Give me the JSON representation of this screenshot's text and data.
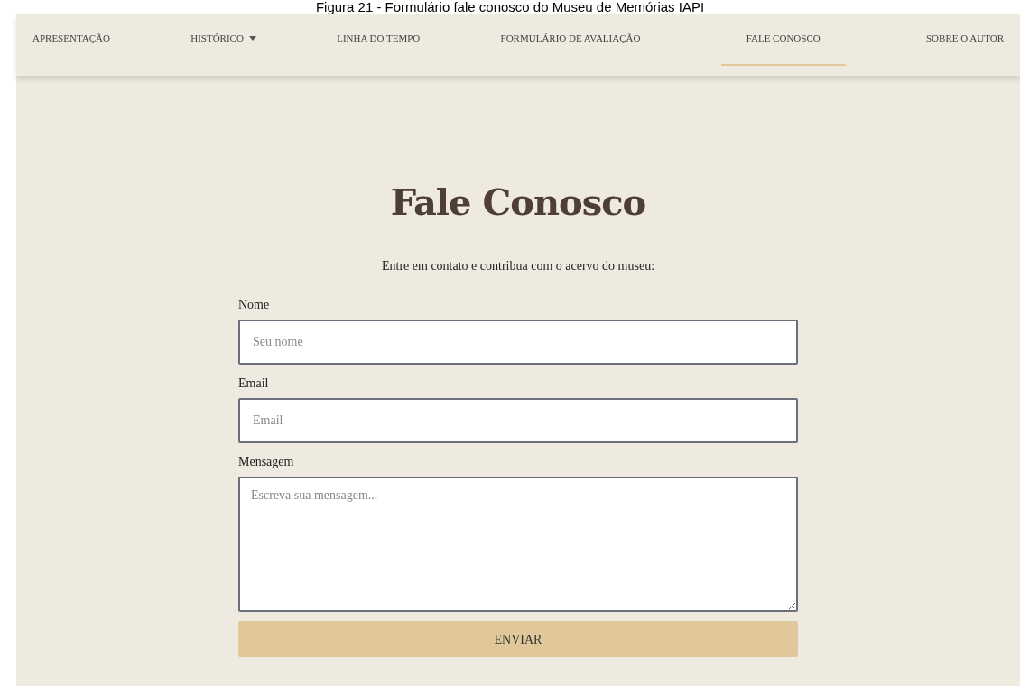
{
  "caption": "Figura 21 - Formulário fale conosco do Museu de Memórias IAPI",
  "nav": [
    {
      "label": "APRESENTAÇÃO",
      "selected": false,
      "dropdown": false
    },
    {
      "label": "HISTÓRICO",
      "selected": false,
      "dropdown": true
    },
    {
      "label": "LINHA DO TEMPO",
      "selected": false,
      "dropdown": false
    },
    {
      "label": "FORMULÁRIO DE AVALIAÇÃO",
      "selected": false,
      "dropdown": false
    },
    {
      "label": "FALE CONOSCO",
      "selected": true,
      "dropdown": false
    },
    {
      "label": "SOBRE O AUTOR",
      "selected": false,
      "dropdown": false
    }
  ],
  "title": "Fale Conosco",
  "subtitle": "Entre em contato e contribua com o acervo do museu:",
  "fields": [
    {
      "label": "Nome",
      "placeholder": "Seu nome",
      "kind": "input"
    },
    {
      "label": "Email",
      "placeholder": "Email",
      "kind": "input"
    },
    {
      "label": "Mensagem",
      "placeholder": "Escreva sua mensagem...",
      "kind": "textarea"
    }
  ],
  "submit": "ENVIAR"
}
